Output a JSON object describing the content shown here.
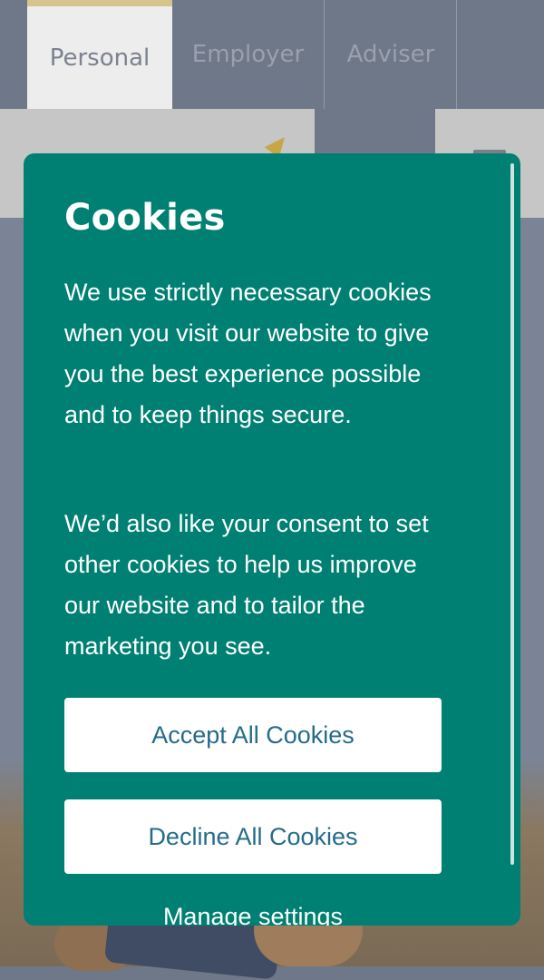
{
  "nav": {
    "tabs": [
      {
        "label": "Personal",
        "active": true
      },
      {
        "label": "Employer",
        "active": false
      },
      {
        "label": "Adviser",
        "active": false
      }
    ]
  },
  "cookie_modal": {
    "title": "Cookies",
    "paragraph_1": "We use strictly necessary cookies when you visit our website to give you the best experience possible and to keep things secure.",
    "paragraph_2": "We’d also like your consent to set other cookies to help us improve our website and to tailor the marketing you see.",
    "accept_label": "Accept All Cookies",
    "decline_label": "Decline All Cookies",
    "manage_label": "Manage settings"
  },
  "colors": {
    "modal_background": "#008073",
    "button_text": "#256c8a",
    "active_tab_accent": "#d5c48b"
  }
}
